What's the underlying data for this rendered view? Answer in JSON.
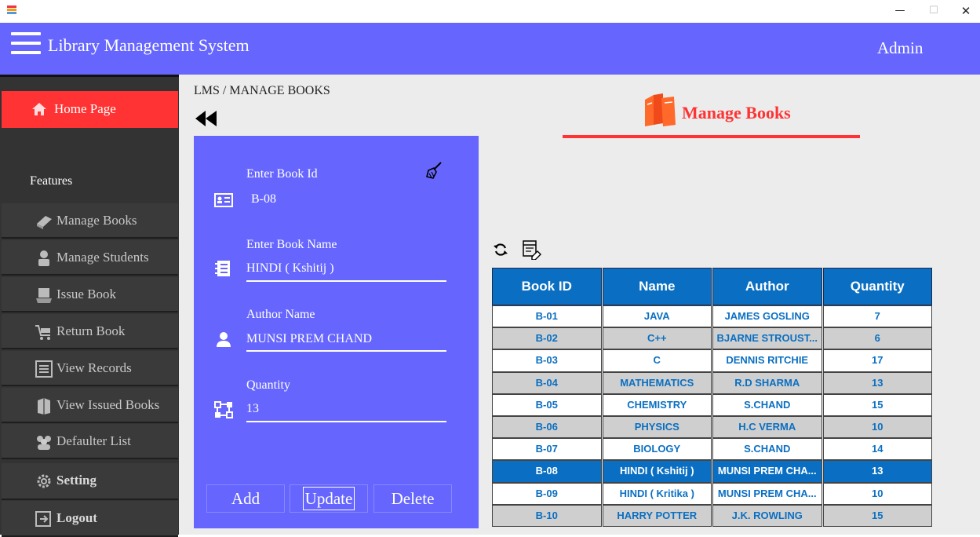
{
  "window": {
    "minimize": "—",
    "maximize": "☐",
    "close": "✕"
  },
  "header": {
    "title": "Library Management System",
    "user": "Admin",
    "color": "#6666ff"
  },
  "sidebar": {
    "home": "Home Page",
    "section": "Features",
    "items": [
      {
        "label": "Manage Books",
        "icon": "book-icon"
      },
      {
        "label": "Manage Students",
        "icon": "student-icon"
      },
      {
        "label": "Issue Book",
        "icon": "issue-book-icon"
      },
      {
        "label": "Return Book",
        "icon": "cart-icon"
      },
      {
        "label": "View Records",
        "icon": "list-icon"
      },
      {
        "label": "View Issued Books",
        "icon": "books-icon"
      },
      {
        "label": "Defaulter List",
        "icon": "group-icon"
      },
      {
        "label": "Setting",
        "icon": "gear-icon"
      },
      {
        "label": "Logout",
        "icon": "logout-icon"
      }
    ]
  },
  "main": {
    "breadcrumb": "LMS / MANAGE BOOKS",
    "heading": "Manage Books",
    "accent": "#ff3333"
  },
  "form": {
    "book_id_label": "Enter Book Id",
    "book_id_value": "B-08",
    "book_name_label": "Enter Book Name",
    "book_name_value": "HINDI ( Kshitij )",
    "author_label": "Author Name",
    "author_value": "MUNSI PREM CHAND",
    "quantity_label": "Quantity",
    "quantity_value": "13",
    "add_label": "Add",
    "update_label": "Update",
    "delete_label": "Delete"
  },
  "table": {
    "columns": [
      "Book ID",
      "Name",
      "Author",
      "Quantity"
    ],
    "selected_row": 7,
    "rows": [
      [
        "B-01",
        "JAVA",
        "JAMES GOSLING",
        "7"
      ],
      [
        "B-02",
        "C++",
        "BJARNE STROUST...",
        "6"
      ],
      [
        "B-03",
        "C",
        "DENNIS RITCHIE",
        "17"
      ],
      [
        "B-04",
        "MATHEMATICS",
        "R.D SHARMA",
        "13"
      ],
      [
        "B-05",
        "CHEMISTRY",
        "S.CHAND",
        "15"
      ],
      [
        "B-06",
        "PHYSICS",
        "H.C VERMA",
        "10"
      ],
      [
        "B-07",
        "BIOLOGY",
        "S.CHAND",
        "14"
      ],
      [
        "B-08",
        "HINDI ( Kshitij )",
        "MUNSI PREM CHA...",
        "13"
      ],
      [
        "B-09",
        "HINDI ( Kritika )",
        "MUNSI PREM CHA...",
        "10"
      ],
      [
        "B-10",
        "HARRY POTTER",
        "J.K. ROWLING",
        "15"
      ]
    ]
  }
}
